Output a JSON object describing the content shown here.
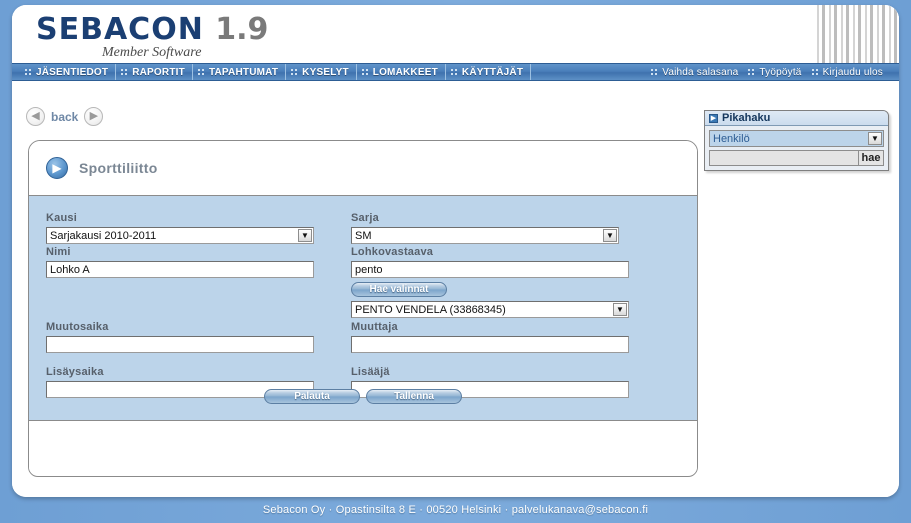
{
  "header": {
    "logo_name": "SEBACON",
    "logo_version": "1.9",
    "tagline": "Member Software"
  },
  "nav": {
    "left_items": [
      {
        "label": "JÄSENTIEDOT",
        "icon": "dot-grid-icon"
      },
      {
        "label": "RAPORTIT",
        "icon": "dot-grid-icon"
      },
      {
        "label": "TAPAHTUMAT",
        "icon": "dot-grid-icon"
      },
      {
        "label": "KYSELYT",
        "icon": "dot-grid-icon"
      },
      {
        "label": "LOMAKKEET",
        "icon": "dot-grid-icon"
      },
      {
        "label": "KÄYTTÄJÄT",
        "icon": "dot-grid-icon"
      }
    ],
    "right_items": [
      {
        "label": "Vaihda salasana",
        "icon": "dot-grid-icon"
      },
      {
        "label": "Työpöytä",
        "icon": "dot-grid-icon"
      },
      {
        "label": "Kirjaudu ulos",
        "icon": "dot-grid-icon"
      }
    ]
  },
  "back_bar": {
    "prev_icon": "arrow-left-circle-icon",
    "label": "back",
    "next_icon": "arrow-right-circle-icon"
  },
  "card": {
    "title": "Sporttiliitto",
    "title_icon": "arrow-right-circle-icon"
  },
  "form": {
    "kausi": {
      "label": "Kausi",
      "value": "Sarjakausi 2010-2011",
      "options": [
        "Sarjakausi 2010-2011"
      ]
    },
    "sarja": {
      "label": "Sarja",
      "value": "SM",
      "options": [
        "SM"
      ]
    },
    "nimi": {
      "label": "Nimi",
      "value": "Lohko A",
      "placeholder": ""
    },
    "lohkovastaava": {
      "label": "Lohkovastaava",
      "value": "pento",
      "placeholder": "",
      "search_button": "Hae valinnat",
      "result_value": "PENTO VENDELA (33868345)",
      "result_options": [
        "PENTO VENDELA (33868345)"
      ]
    },
    "muutosaika": {
      "label": "Muutosaika",
      "value": "",
      "placeholder": ""
    },
    "muuttaja": {
      "label": "Muuttaja",
      "value": "",
      "placeholder": ""
    },
    "lisaysaika": {
      "label": "Lisäysaika",
      "value": "",
      "placeholder": ""
    },
    "lisaaja": {
      "label": "Lisääjä",
      "value": "",
      "placeholder": ""
    },
    "reset_button": "Palauta",
    "save_button": "Tallenna"
  },
  "pikahaku": {
    "title": "Pikahaku",
    "title_icon": "arrow-right-box-icon",
    "type_value": "Henkilö",
    "type_options": [
      "Henkilö"
    ],
    "query_value": "",
    "query_placeholder": "",
    "search_button": "hae"
  },
  "footer": {
    "text": "Sebacon Oy · Opastinsilta 8 E · 00520 Helsinki · palvelukanava@sebacon.fi"
  },
  "colors": {
    "page_bg": "#6e9fd4",
    "nav_bar": "#4a7fba",
    "form_bg": "#bcd4ea",
    "logo_blue": "#1b3f73",
    "title_gray": "#7b8794"
  }
}
